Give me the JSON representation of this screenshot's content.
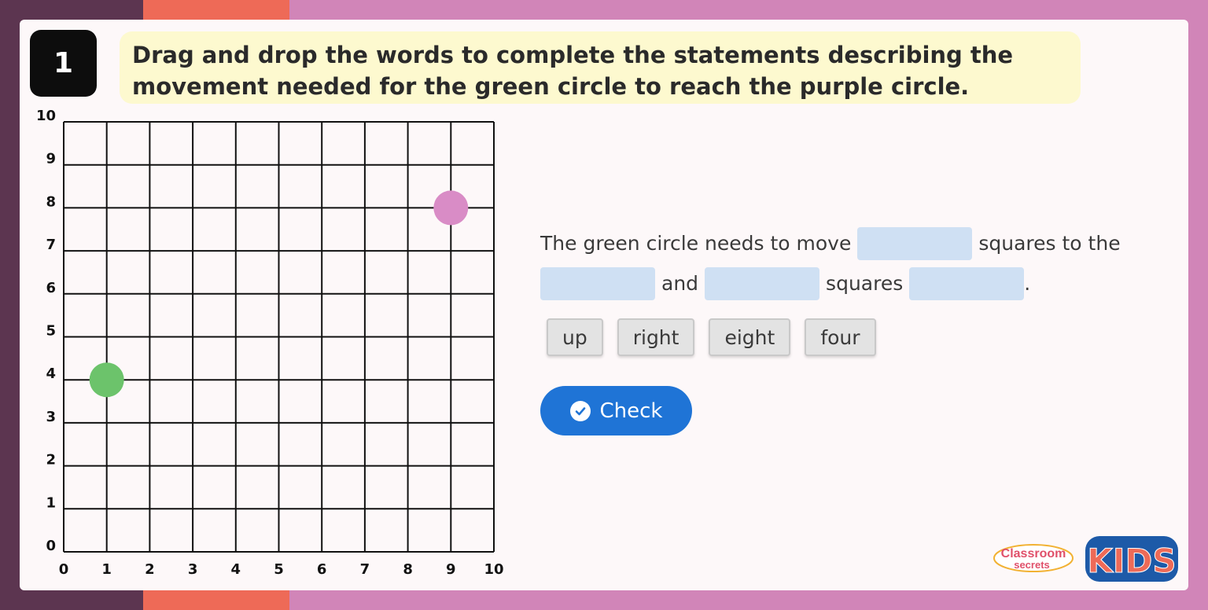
{
  "question_number": "1",
  "instruction": "Drag and drop the words to complete the statements describing the movement needed for the green circle to reach the purple circle.",
  "grid": {
    "x_ticks": [
      "0",
      "1",
      "2",
      "3",
      "4",
      "5",
      "6",
      "7",
      "8",
      "9",
      "10"
    ],
    "y_ticks": [
      "0",
      "1",
      "2",
      "3",
      "4",
      "5",
      "6",
      "7",
      "8",
      "9",
      "10"
    ],
    "points": [
      {
        "name": "green circle",
        "x": 1,
        "y": 4,
        "color": "#6cc36b"
      },
      {
        "name": "purple circle",
        "x": 9,
        "y": 8,
        "color": "#d98cc6"
      }
    ]
  },
  "sentence": {
    "part1": "The green circle needs to move",
    "part2": "squares to the",
    "part3": "and",
    "part4": "squares",
    "part5": "."
  },
  "word_bank": [
    "up",
    "right",
    "eight",
    "four"
  ],
  "check_label": "Check",
  "logo": {
    "brand_text_1": "Classroom",
    "brand_text_2": "secrets",
    "brand_text_3": "KIDS"
  },
  "colors": {
    "blank": "#cfe0f3",
    "button": "#1f74d6"
  }
}
